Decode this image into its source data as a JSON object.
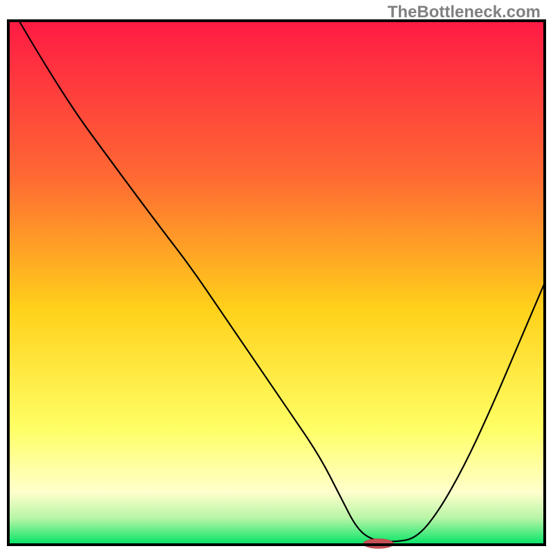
{
  "watermark": "TheBottleneck.com",
  "colors": {
    "border": "#000000",
    "curve": "#000000",
    "marker_fill": "#c94f56",
    "marker_stroke": "#b8444a",
    "gradient_top": "#ff1a44",
    "gradient_mid_upper": "#ff6a33",
    "gradient_mid": "#ffd11a",
    "gradient_mid_lower": "#ffff66",
    "gradient_pale": "#ffffcc",
    "gradient_green_hint": "#b6f5a6",
    "gradient_green": "#00e466"
  },
  "chart_data": {
    "type": "line",
    "title": "",
    "xlabel": "",
    "ylabel": "",
    "xlim": [
      0,
      100
    ],
    "ylim": [
      0,
      100
    ],
    "series": [
      {
        "name": "bottleneck-curve",
        "x": [
          2,
          10,
          20,
          28,
          34,
          40,
          46,
          52,
          58,
          62,
          65,
          68,
          72,
          76,
          80,
          85,
          90,
          95,
          100
        ],
        "values": [
          100,
          86,
          72,
          61,
          53,
          44,
          35,
          26,
          17,
          9,
          3,
          0.8,
          0.5,
          1.2,
          6,
          15,
          26,
          38,
          50
        ]
      }
    ],
    "optimum_marker": {
      "x": 69,
      "y": 0.2,
      "rx": 2.8,
      "ry": 0.9
    }
  }
}
